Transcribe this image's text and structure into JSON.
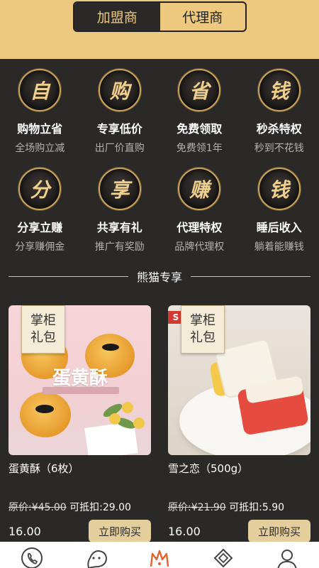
{
  "header": {
    "tabs": [
      {
        "label": "加盟商",
        "active": true
      },
      {
        "label": "代理商",
        "active": false
      }
    ]
  },
  "features": [
    {
      "glyph": "自",
      "title": "购物立省",
      "subtitle": "全场购立减"
    },
    {
      "glyph": "购",
      "title": "专享低价",
      "subtitle": "出厂价直购"
    },
    {
      "glyph": "省",
      "title": "免费领取",
      "subtitle": "免费领1年"
    },
    {
      "glyph": "钱",
      "title": "秒杀特权",
      "subtitle": "秒到不花钱"
    },
    {
      "glyph": "分",
      "title": "分享立赚",
      "subtitle": "分享赚佣金"
    },
    {
      "glyph": "享",
      "title": "共享有礼",
      "subtitle": "推广有奖励"
    },
    {
      "glyph": "赚",
      "title": "代理特权",
      "subtitle": "品牌代理权"
    },
    {
      "glyph": "钱",
      "title": "睡后收入",
      "subtitle": "躺着能赚钱"
    }
  ],
  "section": {
    "title": "熊猫专享"
  },
  "products": [
    {
      "tag_line1": "掌柜",
      "tag_line2": "礼包",
      "image_text": "蛋黄酥",
      "name": "蛋黄酥（6枚）",
      "orig_label": "原价:¥45.00",
      "deduct_label": "可抵扣:29.00",
      "price": "16.00",
      "buy_label": "立即购买"
    },
    {
      "tag_line1": "掌柜",
      "tag_line2": "礼包",
      "image_flag": "S",
      "name": "雪之恋（500g）",
      "orig_label": "原价:¥21.90",
      "deduct_label": "可抵扣:5.90",
      "price": "16.00",
      "buy_label": "立即购买"
    }
  ],
  "tabbar": {
    "icons": [
      "phone-icon",
      "chat-face-icon",
      "crown-icon",
      "diamond-icon",
      "user-icon"
    ],
    "active_color": "#e6622b",
    "inactive_color": "#444444"
  },
  "colors": {
    "gold": "#ecc97e",
    "dark": "#2b2928",
    "button": "#e4cf9c"
  }
}
